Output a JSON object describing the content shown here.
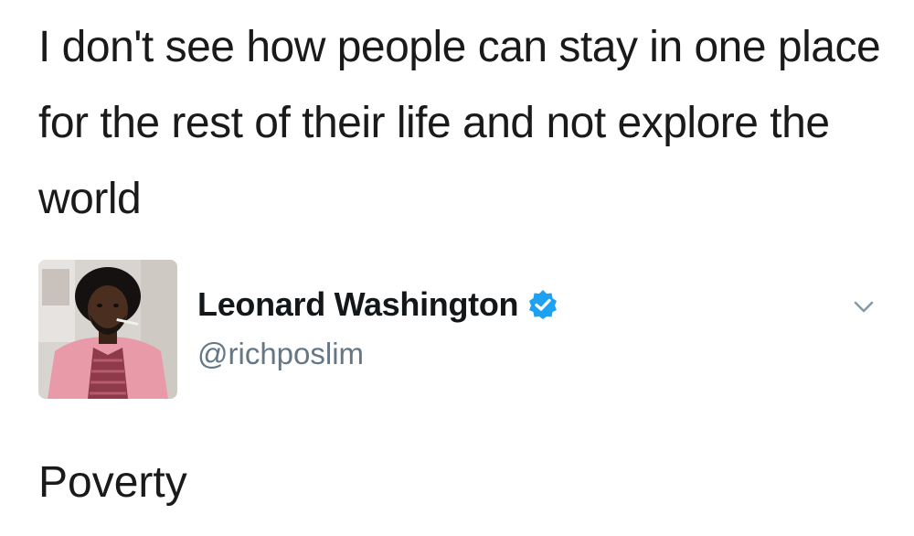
{
  "quote": {
    "text": "I don't see how people can stay in one place for the rest of their life and not explore the world"
  },
  "author": {
    "display_name": "Leonard Washington",
    "handle": "@richposlim",
    "verified": true,
    "avatar_icon": "profile-photo",
    "menu_icon": "chevron-down-icon"
  },
  "tweet": {
    "text": "Poverty"
  },
  "colors": {
    "verified_badge": "#1da1f2",
    "handle": "#657786",
    "name": "#14171a"
  }
}
